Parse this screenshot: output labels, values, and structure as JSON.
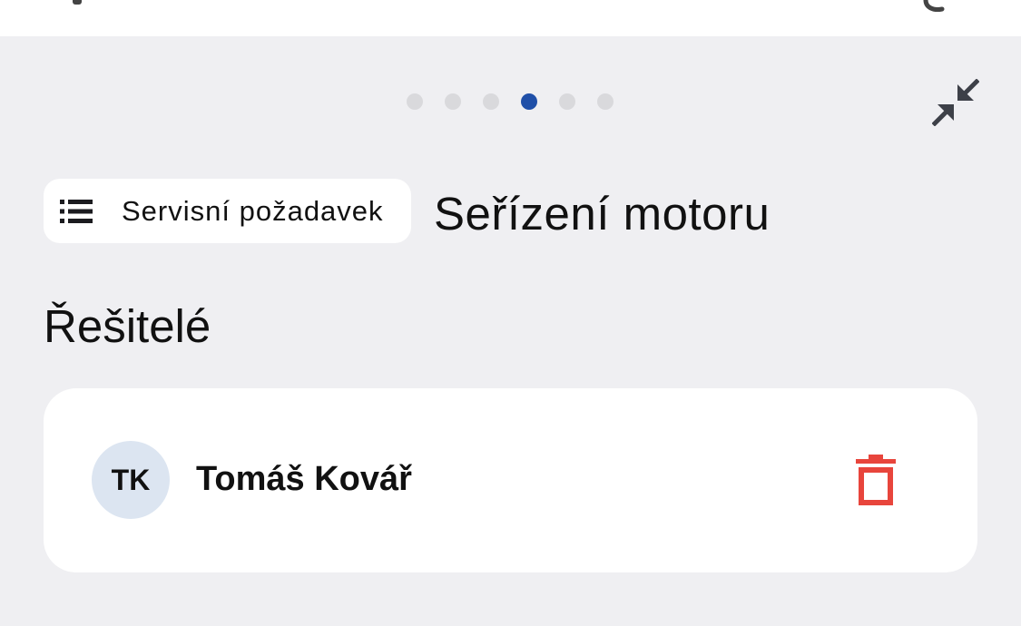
{
  "colors": {
    "background": "#efeff2",
    "surface": "#ffffff",
    "active_dot": "#1f4fa8",
    "inactive_dot": "#d9d9dc",
    "delete": "#e8453c",
    "avatar_bg": "#dce5f1"
  },
  "pager": {
    "total": 6,
    "active_index": 3
  },
  "icons": {
    "collapse": "collapse-arrows-icon",
    "list": "list-icon",
    "delete": "trash-icon"
  },
  "breadcrumb_chip": {
    "label": "Servisní požadavek"
  },
  "page": {
    "title": "Seřízení motoru",
    "section_title": "Řešitelé"
  },
  "assignees": [
    {
      "initials": "TK",
      "name": "Tomáš Kovář"
    }
  ]
}
